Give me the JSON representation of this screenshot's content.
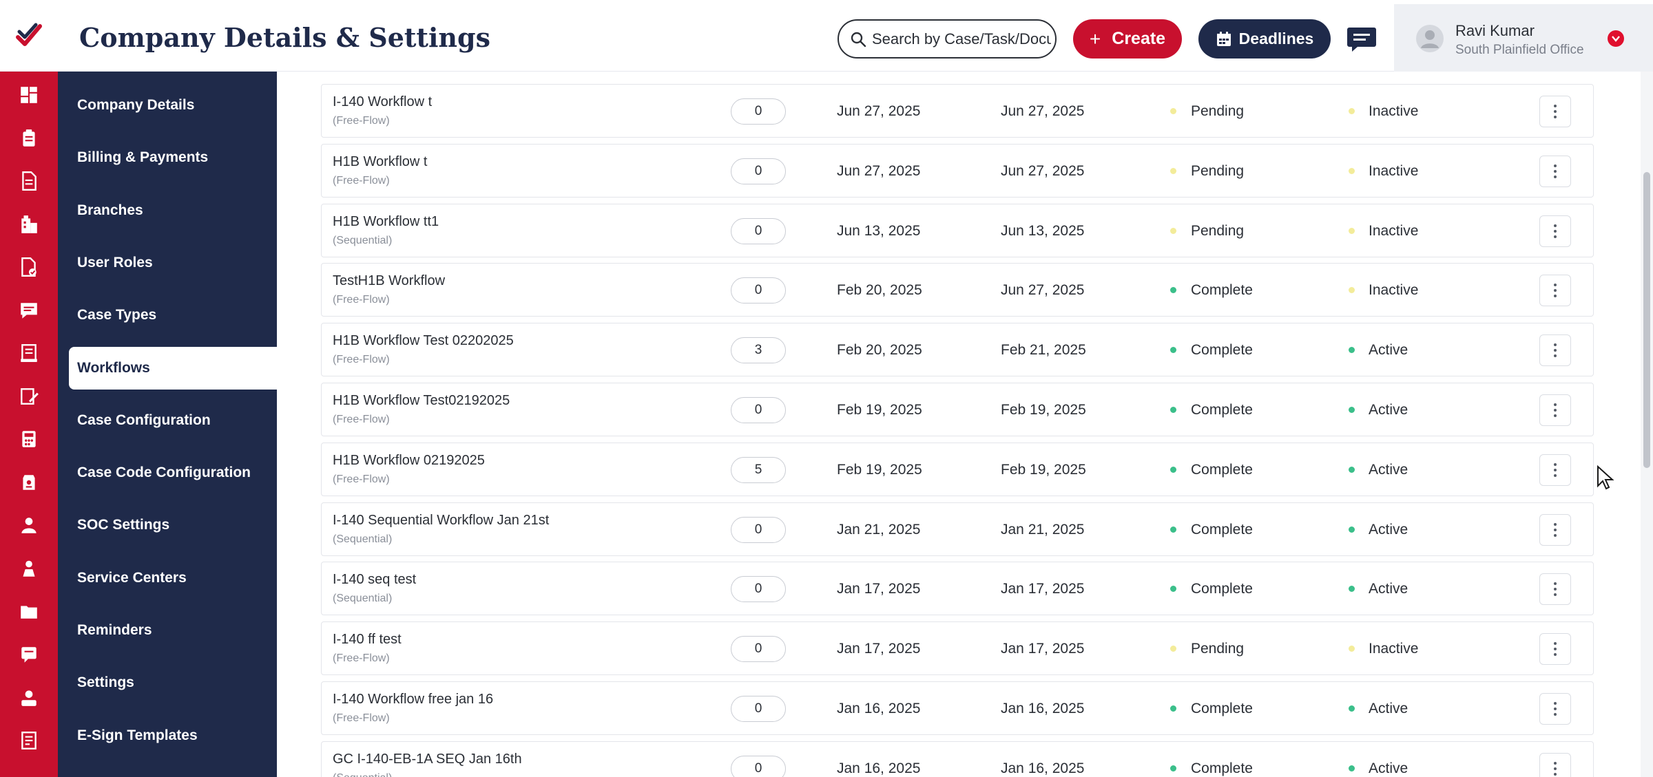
{
  "header": {
    "title": "Company Details & Settings",
    "search_placeholder": "Search by Case/Task/Document",
    "create_label": "Create",
    "deadlines_label": "Deadlines",
    "user": {
      "name": "Ravi Kumar",
      "office": "South Plainfield Office"
    }
  },
  "rail_icons": [
    "dashboard-icon",
    "clipboard-icon",
    "document-icon",
    "building-icon",
    "document-check-icon",
    "chat-icon",
    "ledger-icon",
    "edit-icon",
    "calculator-icon",
    "badge-icon",
    "user-icon",
    "user-alt-icon",
    "folder-icon",
    "message-icon",
    "user-card-icon",
    "book-icon"
  ],
  "settings_nav": [
    {
      "label": "Company Details",
      "active": false
    },
    {
      "label": "Billing & Payments",
      "active": false
    },
    {
      "label": "Branches",
      "active": false
    },
    {
      "label": "User Roles",
      "active": false
    },
    {
      "label": "Case Types",
      "active": false
    },
    {
      "label": "Workflows",
      "active": true
    },
    {
      "label": "Case Configuration",
      "active": false
    },
    {
      "label": "Case Code Configuration",
      "active": false
    },
    {
      "label": "SOC Settings",
      "active": false
    },
    {
      "label": "Service Centers",
      "active": false
    },
    {
      "label": "Reminders",
      "active": false
    },
    {
      "label": "Settings",
      "active": false
    },
    {
      "label": "E-Sign Templates",
      "active": false
    }
  ],
  "colors": {
    "brand_red": "#c8102e",
    "navy": "#1f2a4a",
    "complete": "#3bbf8a",
    "pending": "#f3ec9a"
  },
  "workflows": [
    {
      "name": "I-140 Workflow t",
      "type": "(Free-Flow)",
      "count": "0",
      "start": "Jun 27, 2025",
      "end": "Jun 27, 2025",
      "status": "Pending",
      "active": "Inactive"
    },
    {
      "name": "H1B Workflow t",
      "type": "(Free-Flow)",
      "count": "0",
      "start": "Jun 27, 2025",
      "end": "Jun 27, 2025",
      "status": "Pending",
      "active": "Inactive"
    },
    {
      "name": "H1B Workflow tt1",
      "type": "(Sequential)",
      "count": "0",
      "start": "Jun 13, 2025",
      "end": "Jun 13, 2025",
      "status": "Pending",
      "active": "Inactive"
    },
    {
      "name": "TestH1B Workflow",
      "type": "(Free-Flow)",
      "count": "0",
      "start": "Feb 20, 2025",
      "end": "Jun 27, 2025",
      "status": "Complete",
      "active": "Inactive"
    },
    {
      "name": "H1B Workflow Test 02202025",
      "type": "(Free-Flow)",
      "count": "3",
      "start": "Feb 20, 2025",
      "end": "Feb 21, 2025",
      "status": "Complete",
      "active": "Active"
    },
    {
      "name": "H1B Workflow Test02192025",
      "type": "(Free-Flow)",
      "count": "0",
      "start": "Feb 19, 2025",
      "end": "Feb 19, 2025",
      "status": "Complete",
      "active": "Active"
    },
    {
      "name": "H1B Workflow 02192025",
      "type": "(Free-Flow)",
      "count": "5",
      "start": "Feb 19, 2025",
      "end": "Feb 19, 2025",
      "status": "Complete",
      "active": "Active"
    },
    {
      "name": "I-140 Sequential Workflow Jan 21st",
      "type": "(Sequential)",
      "count": "0",
      "start": "Jan 21, 2025",
      "end": "Jan 21, 2025",
      "status": "Complete",
      "active": "Active"
    },
    {
      "name": "I-140 seq test",
      "type": "(Sequential)",
      "count": "0",
      "start": "Jan 17, 2025",
      "end": "Jan 17, 2025",
      "status": "Complete",
      "active": "Active"
    },
    {
      "name": "I-140 ff test",
      "type": "(Free-Flow)",
      "count": "0",
      "start": "Jan 17, 2025",
      "end": "Jan 17, 2025",
      "status": "Pending",
      "active": "Inactive"
    },
    {
      "name": "I-140 Workflow free jan 16",
      "type": "(Free-Flow)",
      "count": "0",
      "start": "Jan 16, 2025",
      "end": "Jan 16, 2025",
      "status": "Complete",
      "active": "Active"
    },
    {
      "name": "GC I-140-EB-1A SEQ Jan 16th",
      "type": "(Sequential)",
      "count": "0",
      "start": "Jan 16, 2025",
      "end": "Jan 16, 2025",
      "status": "Complete",
      "active": "Active"
    }
  ]
}
